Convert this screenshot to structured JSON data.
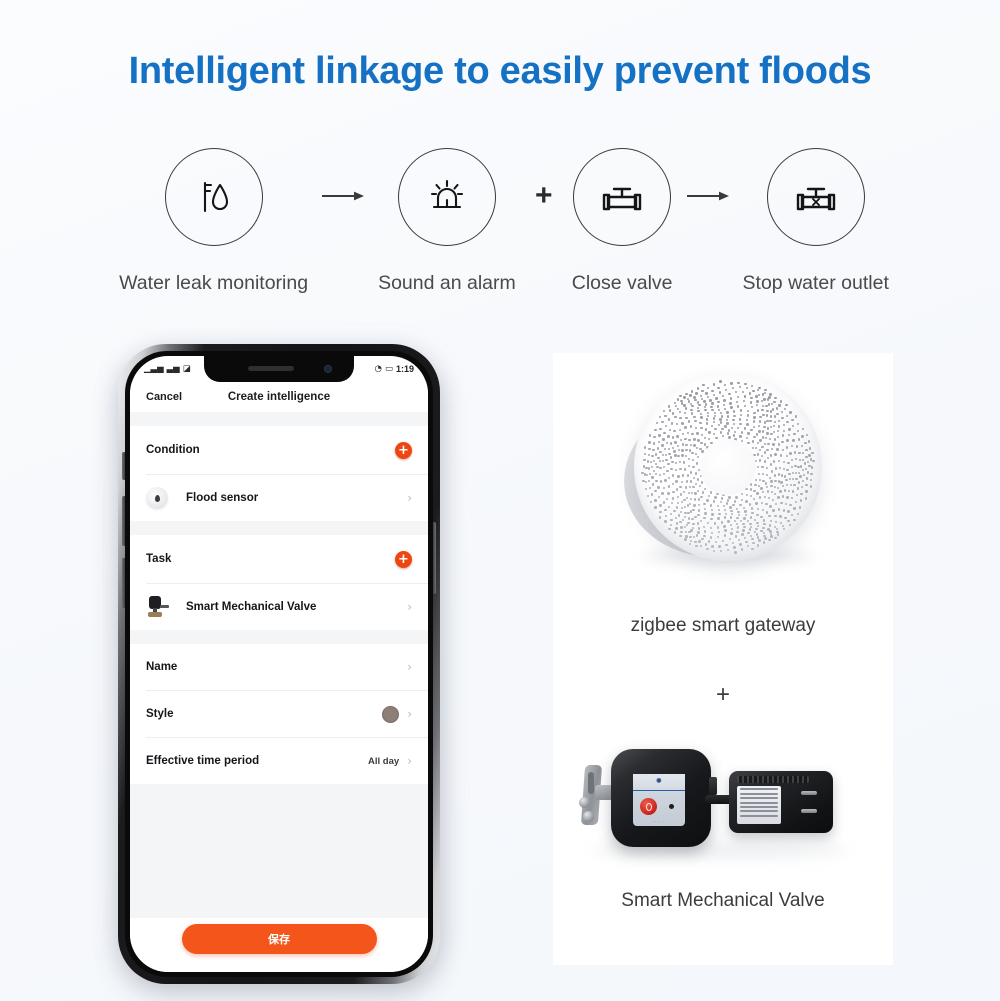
{
  "headline": "Intelligent linkage to easily prevent floods",
  "theme": {
    "title_blue": "#1471c4",
    "accent_orange": "#ee4612",
    "save_orange": "#f4551b",
    "background": "#f7f9fc"
  },
  "flow": {
    "steps": [
      {
        "label": "Water leak monitoring",
        "icon": "water-drop-faucet-icon"
      },
      {
        "label": "Sound an alarm",
        "icon": "alarm-siren-icon"
      },
      {
        "label": "Close valve",
        "icon": "valve-icon"
      },
      {
        "label": "Stop water outlet",
        "icon": "valve-closed-icon"
      }
    ],
    "connectors": [
      "arrow-right-icon",
      "plus-icon",
      "arrow-right-icon"
    ],
    "plus_symbol": "+"
  },
  "phone": {
    "status_bar": {
      "left_icons": "signal-bars-icon",
      "wifi": "wifi-icon",
      "battery": "battery-icon",
      "time": "1:19"
    },
    "app_bar": {
      "cancel_label": "Cancel",
      "title": "Create intelligence"
    },
    "sections": [
      {
        "header": "Condition",
        "add_icon": "plus-circle-icon",
        "items": [
          {
            "label": "Flood sensor",
            "thumb": "flood-sensor-thumb",
            "chevron": "chevron-right-icon"
          }
        ]
      },
      {
        "header": "Task",
        "add_icon": "plus-circle-icon",
        "items": [
          {
            "label": "Smart Mechanical Valve",
            "thumb": "valve-thumb",
            "chevron": "chevron-right-icon"
          }
        ]
      }
    ],
    "settings": [
      {
        "label": "Name",
        "value": "",
        "chevron": "chevron-right-icon"
      },
      {
        "label": "Style",
        "value": "",
        "swatch_color": "#8c7f78",
        "chevron": "chevron-right-icon"
      },
      {
        "label": "Effective time period",
        "value": "All day",
        "chevron": "chevron-right-icon"
      }
    ],
    "save_button": "保存"
  },
  "products": {
    "gateway": {
      "label": "zigbee smart gateway",
      "image": "zigbee-gateway-photo"
    },
    "separator": "+",
    "valve": {
      "label": "Smart Mechanical Valve",
      "image": "smart-mechanical-valve-photo"
    }
  }
}
